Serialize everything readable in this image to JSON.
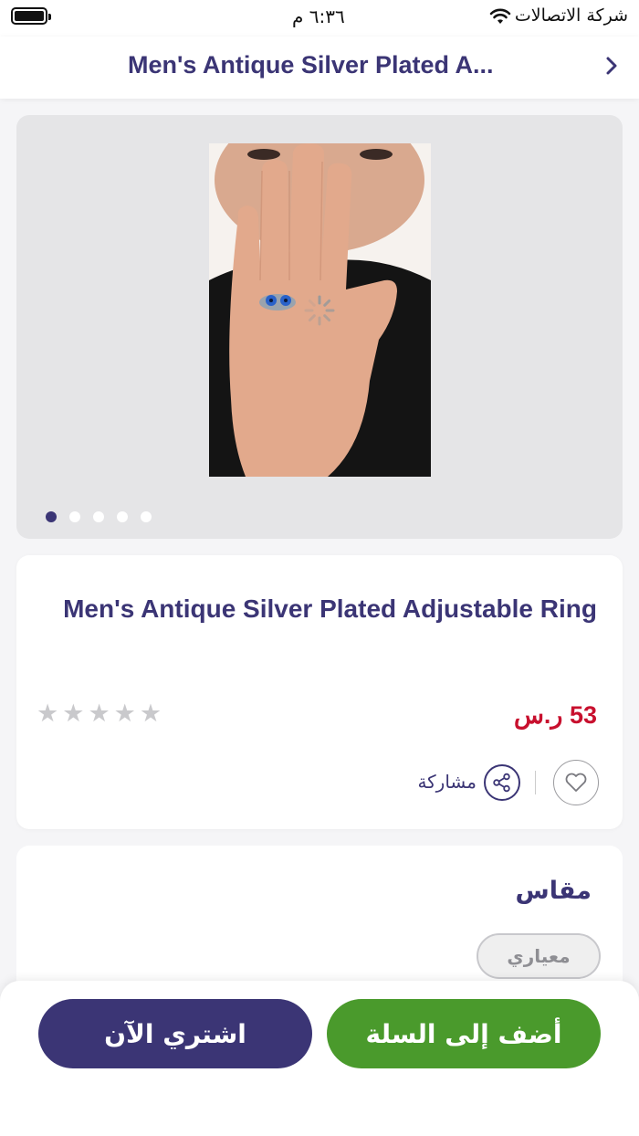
{
  "status_bar": {
    "time": "٦:٣٦ م",
    "carrier": "شركة الاتصالات"
  },
  "header": {
    "title": "Men's Antique Silver Plated A..."
  },
  "gallery": {
    "dots": [
      true,
      false,
      false,
      false,
      false
    ]
  },
  "product": {
    "name": "Men's Antique Silver Plated Adjustable Ring",
    "price": "53 ر.س",
    "rating": 0,
    "stars": [
      "★",
      "★",
      "★",
      "★",
      "★"
    ],
    "share_label": "مشاركة"
  },
  "size": {
    "title": "مقاس",
    "option": "معياري"
  },
  "actions": {
    "buy_now": "اشتري الآن",
    "add_to_cart": "أضف إلى السلة"
  },
  "colors": {
    "primary": "#3b3575",
    "cart": "#4a9a2c",
    "price": "#c8102e"
  },
  "icons": [
    "battery-icon",
    "wifi-icon",
    "chevron-right-icon",
    "share-icon",
    "heart-icon",
    "star-icon",
    "loading-spinner-icon"
  ]
}
